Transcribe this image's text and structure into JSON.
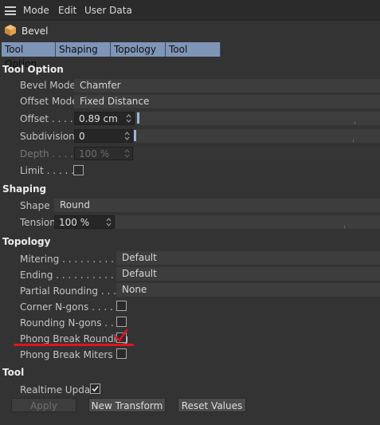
{
  "menubar": {
    "items": [
      "Mode",
      "Edit",
      "User Data"
    ]
  },
  "object": {
    "title": "Bevel"
  },
  "tabs": [
    "Tool Option",
    "Shaping",
    "Topology",
    "Tool"
  ],
  "tool_option": {
    "heading": "Tool Option",
    "bevel_mode": {
      "label": "Bevel Mode",
      "value": "Chamfer"
    },
    "offset_mode": {
      "label": "Offset Mode",
      "value": "Fixed Distance"
    },
    "offset": {
      "label": "Offset . . . . .",
      "value": "0.89 cm"
    },
    "subdivision": {
      "label": "Subdivision",
      "value": "0"
    },
    "depth": {
      "label": "Depth . . . . .",
      "value": "100 %"
    },
    "limit": {
      "label": "Limit . . . . .",
      "checked": false
    }
  },
  "shaping": {
    "heading": "Shaping",
    "shape": {
      "label": "Shape",
      "value": "Round"
    },
    "tension": {
      "label": "Tension",
      "value": "100 %"
    }
  },
  "topology": {
    "heading": "Topology",
    "mitering": {
      "label": "Mitering . . . . . . . . . . .",
      "value": "Default"
    },
    "ending": {
      "label": "Ending . . . . . . . . . . . .",
      "value": "Default"
    },
    "partial_rounding": {
      "label": "Partial Rounding . . . .",
      "value": "None"
    },
    "corner_ngons": {
      "label": "Corner N-gons . . . . .",
      "checked": false
    },
    "rounding_ngons": {
      "label": "Rounding N-gons . . .",
      "checked": false
    },
    "phong_break_rounding": {
      "label": "Phong Break Rounding",
      "checked": true
    },
    "phong_break_miters": {
      "label": "Phong Break Miters . .",
      "checked": false
    }
  },
  "tool": {
    "heading": "Tool",
    "realtime_update": {
      "label": "Realtime Update",
      "checked": true
    },
    "apply_label": "Apply",
    "new_transform_label": "New Transform",
    "reset_values_label": "Reset Values"
  },
  "colors": {
    "background": "#333333",
    "tab_accent": "#7f95b8",
    "annotation_red": "#e0141e"
  }
}
